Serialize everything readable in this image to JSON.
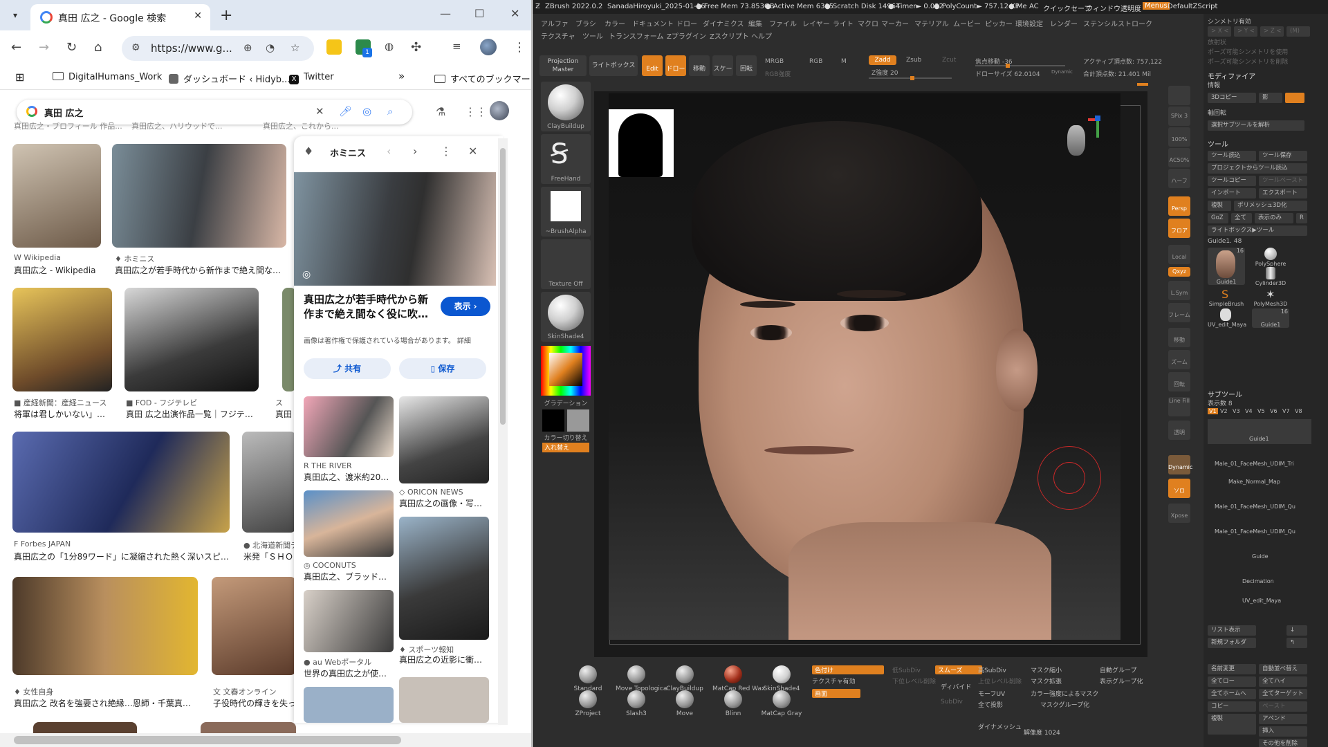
{
  "chrome": {
    "tab": {
      "title": "真田 広之 - Google 検索"
    },
    "url": "https://www.g...",
    "bookmarks": [
      {
        "label": "DigitalHumans_Work",
        "icon": "folder-icon"
      },
      {
        "label": "ダッシュボード ‹ Hidyb...",
        "icon": "site-icon"
      },
      {
        "label": "Twitter",
        "icon": "x-logo-icon"
      }
    ],
    "bookmarks_more": "»",
    "all_bookmarks": "すべてのブックマーク",
    "search": {
      "query": "真田 広之"
    },
    "faded_top": [
      "真田広之・プロフィール 作品...",
      "真田広之、ハリウッドで...",
      "真田広之、これから..."
    ],
    "results": [
      {
        "source": "Wikipedia",
        "title": "真田広之 - Wikipedia",
        "tone": "#8b6f57"
      },
      {
        "source": "ホミニス",
        "title": "真田広之が若手時代から新作まで絶え間な…",
        "tone": "#9aa7b3"
      },
      {
        "source": "産経新聞：産経ニュース",
        "title": "将軍は君しかいない」…",
        "tone": "#c8a23a"
      },
      {
        "source": "FOD - フジテレビ",
        "title": "真田 広之出演作品一覧｜フジテ…",
        "tone": "#555555"
      },
      {
        "source": "ス",
        "title": "真田",
        "tone": "#7a8a6a"
      },
      {
        "source": "Forbes JAPAN",
        "title": "真田広之の「1分89ワード」に凝縮された熱く深いスピ…",
        "tone": "#3a4b8a"
      },
      {
        "source": "北海道新聞デ",
        "title": "米発「ＳＨＯ",
        "tone": "#6a6a6a"
      },
      {
        "source": "女性自身",
        "title": "真田広之 改名を強要され絶縁…恩師・千葉真…",
        "tone": "#b88a3a"
      },
      {
        "source": "文春オンライン",
        "title": "子役時代の輝きを失っ",
        "tone": "#8a6a5a"
      }
    ],
    "panel": {
      "source": "ホミニス",
      "title": "真田広之が若手時代から新作まで絶え間なく役に吹…",
      "show": "表示 ›",
      "note": "画像は著作権で保護されている場合があります。 詳細",
      "share": "共有",
      "save": "保存",
      "grid": [
        {
          "source": "THE RIVER",
          "title": "真田広之、渡米約20…"
        },
        {
          "source": "ORICON NEWS",
          "title": "真田広之の画像・写…"
        },
        {
          "source": "COCONUTS",
          "title": "真田広之、ブラッド…"
        },
        {
          "source": "au Webポータル",
          "title": "世界の真田広之が使…"
        },
        {
          "source": "スポーツ報知",
          "title": "真田広之の近影に衝…"
        }
      ]
    }
  },
  "zbrush": {
    "title_items": [
      "ZBrush 2022.0.2",
      "SanadaHiroyuki_2025-01-16",
      "● Free Mem 73.853GB",
      "● Active Mem 6305",
      "● Scratch Disk 14964",
      "● Timer► 0.032",
      "● PolyCount► 757.12 KP",
      "● Me",
      "AC",
      "クイックセーブ",
      "ウィンドウ透明度",
      "Menus",
      "DefaultZScript"
    ],
    "menus_row1": [
      "アルファ",
      "ブラシ",
      "カラー",
      "ドキュメント",
      "ドロー",
      "ダイナミクス",
      "編集",
      "ファイル",
      "レイヤー",
      "ライト",
      "マクロ",
      "マーカー",
      "マテリアル",
      "ムービー",
      "ピッカー",
      "環境設定",
      "レンダー",
      "ステンシル",
      "ストローク"
    ],
    "menus_row2": [
      "テクスチャ",
      "ツール",
      "トランスフォーム",
      "Zプラグイン",
      "Zスクリプト",
      "ヘルプ"
    ],
    "projection_master": "Projection Master",
    "lightbox": "ライトボックス",
    "edit": "Edit",
    "draw": "ドロー",
    "move": "移動",
    "scale": "スケール",
    "rotate": "回転",
    "mrgb": "MRGB",
    "rgb": "RGB",
    "m": "M",
    "rgb_strength": "RGB強度",
    "zadd": "Zadd",
    "zsub": "Zsub",
    "zcut": "Zcut",
    "z_intensity": "Z強度 20",
    "focal_shift": "焦点移動 -36",
    "draw_size": "ドローサイズ 62.0104",
    "dynamic": "Dynamic",
    "active_points": "アクティブ頂点数: 757,122",
    "total_points": "合計頂点数: 21.401 Mil",
    "left_brushes": [
      {
        "label": "ClayBuildup"
      },
      {
        "label": "FreeHand"
      },
      {
        "label": "~BrushAlpha"
      },
      {
        "label": "Texture Off"
      },
      {
        "label": "SkinShade4"
      }
    ],
    "gradient": "グラデーション",
    "switch_color": "カラー切り替え",
    "swap": "入れ替え",
    "right_shelf": [
      "SPix 3",
      "100%",
      "AC50%",
      "ハーフ",
      "Persp",
      "フロア",
      "Local",
      "L.Sym",
      "Qxyz",
      "フレーム",
      "移動",
      "ズーム",
      "回転",
      "Line Fill",
      "透明",
      "Dynamic",
      "ソロ",
      "Xpose"
    ],
    "tray": {
      "symmetry": "シンメトリ有効",
      "sym_axes": [
        "> X <",
        "> Y <",
        "> Z <",
        "(M)"
      ],
      "radial": "放射状",
      "sym_pose": "ポーズ可能シンメトリを使用",
      "sym_delete": "ポーズ可能シンメトリを削除",
      "modifier": "モディファイア",
      "info": "情報",
      "copy3d": "3Dコピー",
      "shadow": "影",
      "axis_rotate": "軸回転",
      "analyze": "選択サブツールを解析",
      "tool": "ツール",
      "tool_buttons": [
        [
          "ツール読込",
          "ツール保存"
        ],
        [
          "プロジェクトからツール読込",
          ""
        ],
        [
          "ツールコピー",
          "ツールペースト"
        ],
        [
          "インポート",
          "エクスポート"
        ],
        [
          "複製",
          "ポリメッシュ3D化"
        ],
        [
          "GoZ",
          "全て",
          "表示のみ",
          "R"
        ],
        [
          "ライトボックス▶ツール",
          ""
        ]
      ],
      "guide_slider": "Guide1. 48",
      "tool_thumbs": [
        {
          "label": "Guide1",
          "count": "16"
        },
        {
          "label": "PolySphere",
          "count": ""
        },
        {
          "label": "Cylinder3D",
          "count": ""
        },
        {
          "label": "SimpleBrush",
          "count": ""
        },
        {
          "label": "PolyMesh3D",
          "count": ""
        },
        {
          "label": "UV_edit_Maya",
          "count": ""
        },
        {
          "label": "Guide1",
          "count": "16"
        }
      ],
      "subtool": "サブツール",
      "visible_count": "表示数 8",
      "versions": [
        "V1",
        "V2",
        "V3",
        "V4",
        "V5",
        "V6",
        "V7",
        "V8"
      ],
      "subtools": [
        "Guide1",
        "Male_01_FaceMesh_UDIM_Tri",
        "Make_Normal_Map",
        "Male_01_FaceMesh_UDIM_Qu",
        "Male_01_FaceMesh_UDIM_Qu",
        "Guide",
        "Decimation",
        "UV_edit_Maya"
      ],
      "list_show": "リスト表示",
      "new_folder": "新規フォルダ",
      "bottom_buttons": [
        [
          "名前変更",
          "自動並べ替え"
        ],
        [
          "全てロー",
          "全てハイ"
        ],
        [
          "全てホームへ",
          "全てターゲット"
        ],
        [
          "コピー",
          "ペースト"
        ],
        [
          "複製",
          "アペンド"
        ],
        [
          "",
          "挿入"
        ],
        [
          "",
          "その他を削除"
        ]
      ]
    },
    "bottom_brushes": [
      {
        "label": "Standard"
      },
      {
        "label": "Move Topologica"
      },
      {
        "label": "ClayBuildup"
      },
      {
        "label": "MatCap Red Wax"
      },
      {
        "label": "SkinShade4"
      },
      {
        "label": "ZProject"
      },
      {
        "label": "Slash3"
      },
      {
        "label": "Move"
      },
      {
        "label": "Blinn"
      },
      {
        "label": "MatCap Gray"
      }
    ],
    "bottom_panel": {
      "col1": [
        "色付け",
        "テクスチャ有効",
        "画面"
      ],
      "col2": [
        "低SubDiv",
        "下位レベル削除"
      ],
      "smooth": "スムーズ",
      "divide": "ディバイド",
      "subdiv": "SubDiv",
      "dynamesh": "ダイナメッシュ",
      "resolution": "解像度 1024",
      "col3": [
        "高SubDiv",
        "上位レベル削除",
        "モーフUV",
        "全て投影"
      ],
      "col4": [
        "マスク縮小",
        "マスク拡張",
        "カラー強度によるマスク",
        "マスクグループ化"
      ],
      "col5": [
        "自動グループ",
        "表示グループ化"
      ]
    }
  }
}
